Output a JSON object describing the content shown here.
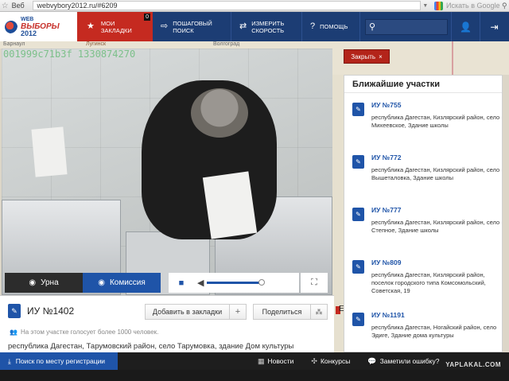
{
  "browser": {
    "site_label": "Веб",
    "url": "webvybory2012.ru/#6209",
    "search_placeholder": "Искать в Google"
  },
  "logo": {
    "line1": "WEB",
    "line2": "ВЫБОРЫ",
    "line3": "2012"
  },
  "nav": {
    "bookmarks_label_1": "МОИ",
    "bookmarks_label_2": "ЗАКЛАДКИ",
    "bookmarks_count": "0",
    "step_search_1": "ПОШАГОВЫЙ",
    "step_search_2": "ПОИСК",
    "speed_1": "ИЗМЕРИТЬ",
    "speed_2": "СКОРОСТЬ",
    "help": "ПОМОЩЬ"
  },
  "map": {
    "label_left": "Барнаул",
    "label_mid": "Лугинск",
    "label_right": "Волгоград"
  },
  "video": {
    "camera_id": "001999c71b3f 1330874270",
    "urna_label": "Урна",
    "komissia_label": "Комиссия"
  },
  "station": {
    "title": "ИУ №1402",
    "add_bookmark": "Добавить в закладки",
    "share": "Поделиться",
    "voters_note": "На этом участке голосует более 1000 человек.",
    "address": "республика Дагестан, Тарумовский район, село Тарумовка, здание Дом культуры"
  },
  "close_button": "Закрыть",
  "nearest": {
    "title": "Ближайшие участки",
    "items": [
      {
        "name": "ИУ №755",
        "address": "республика Дагестан, Кизлярский район, село Михеевское, Здание школы"
      },
      {
        "name": "ИУ №772",
        "address": "республика Дагестан, Кизлярский район, село Вышеталовка, Здание школы"
      },
      {
        "name": "ИУ №777",
        "address": "республика Дагестан, Кизлярский район, село Степное, Здание школы"
      },
      {
        "name": "ИУ №809",
        "address": "республика Дагестан, Кизлярский район, поселок городского типа Комсомольский, Советская, 19"
      },
      {
        "name": "ИУ №1191",
        "address": "республика Дагестан, Ногайский район, село Эдиге, Здание дома культуры"
      }
    ]
  },
  "map_pin_label": "Е",
  "bottom": {
    "search_reg": "Поиск по месту регистрации",
    "news": "Новости",
    "contests": "Конкурсы",
    "report_error": "Заметили ошибку?",
    "watermark": "YAPLAKAL.COM"
  }
}
